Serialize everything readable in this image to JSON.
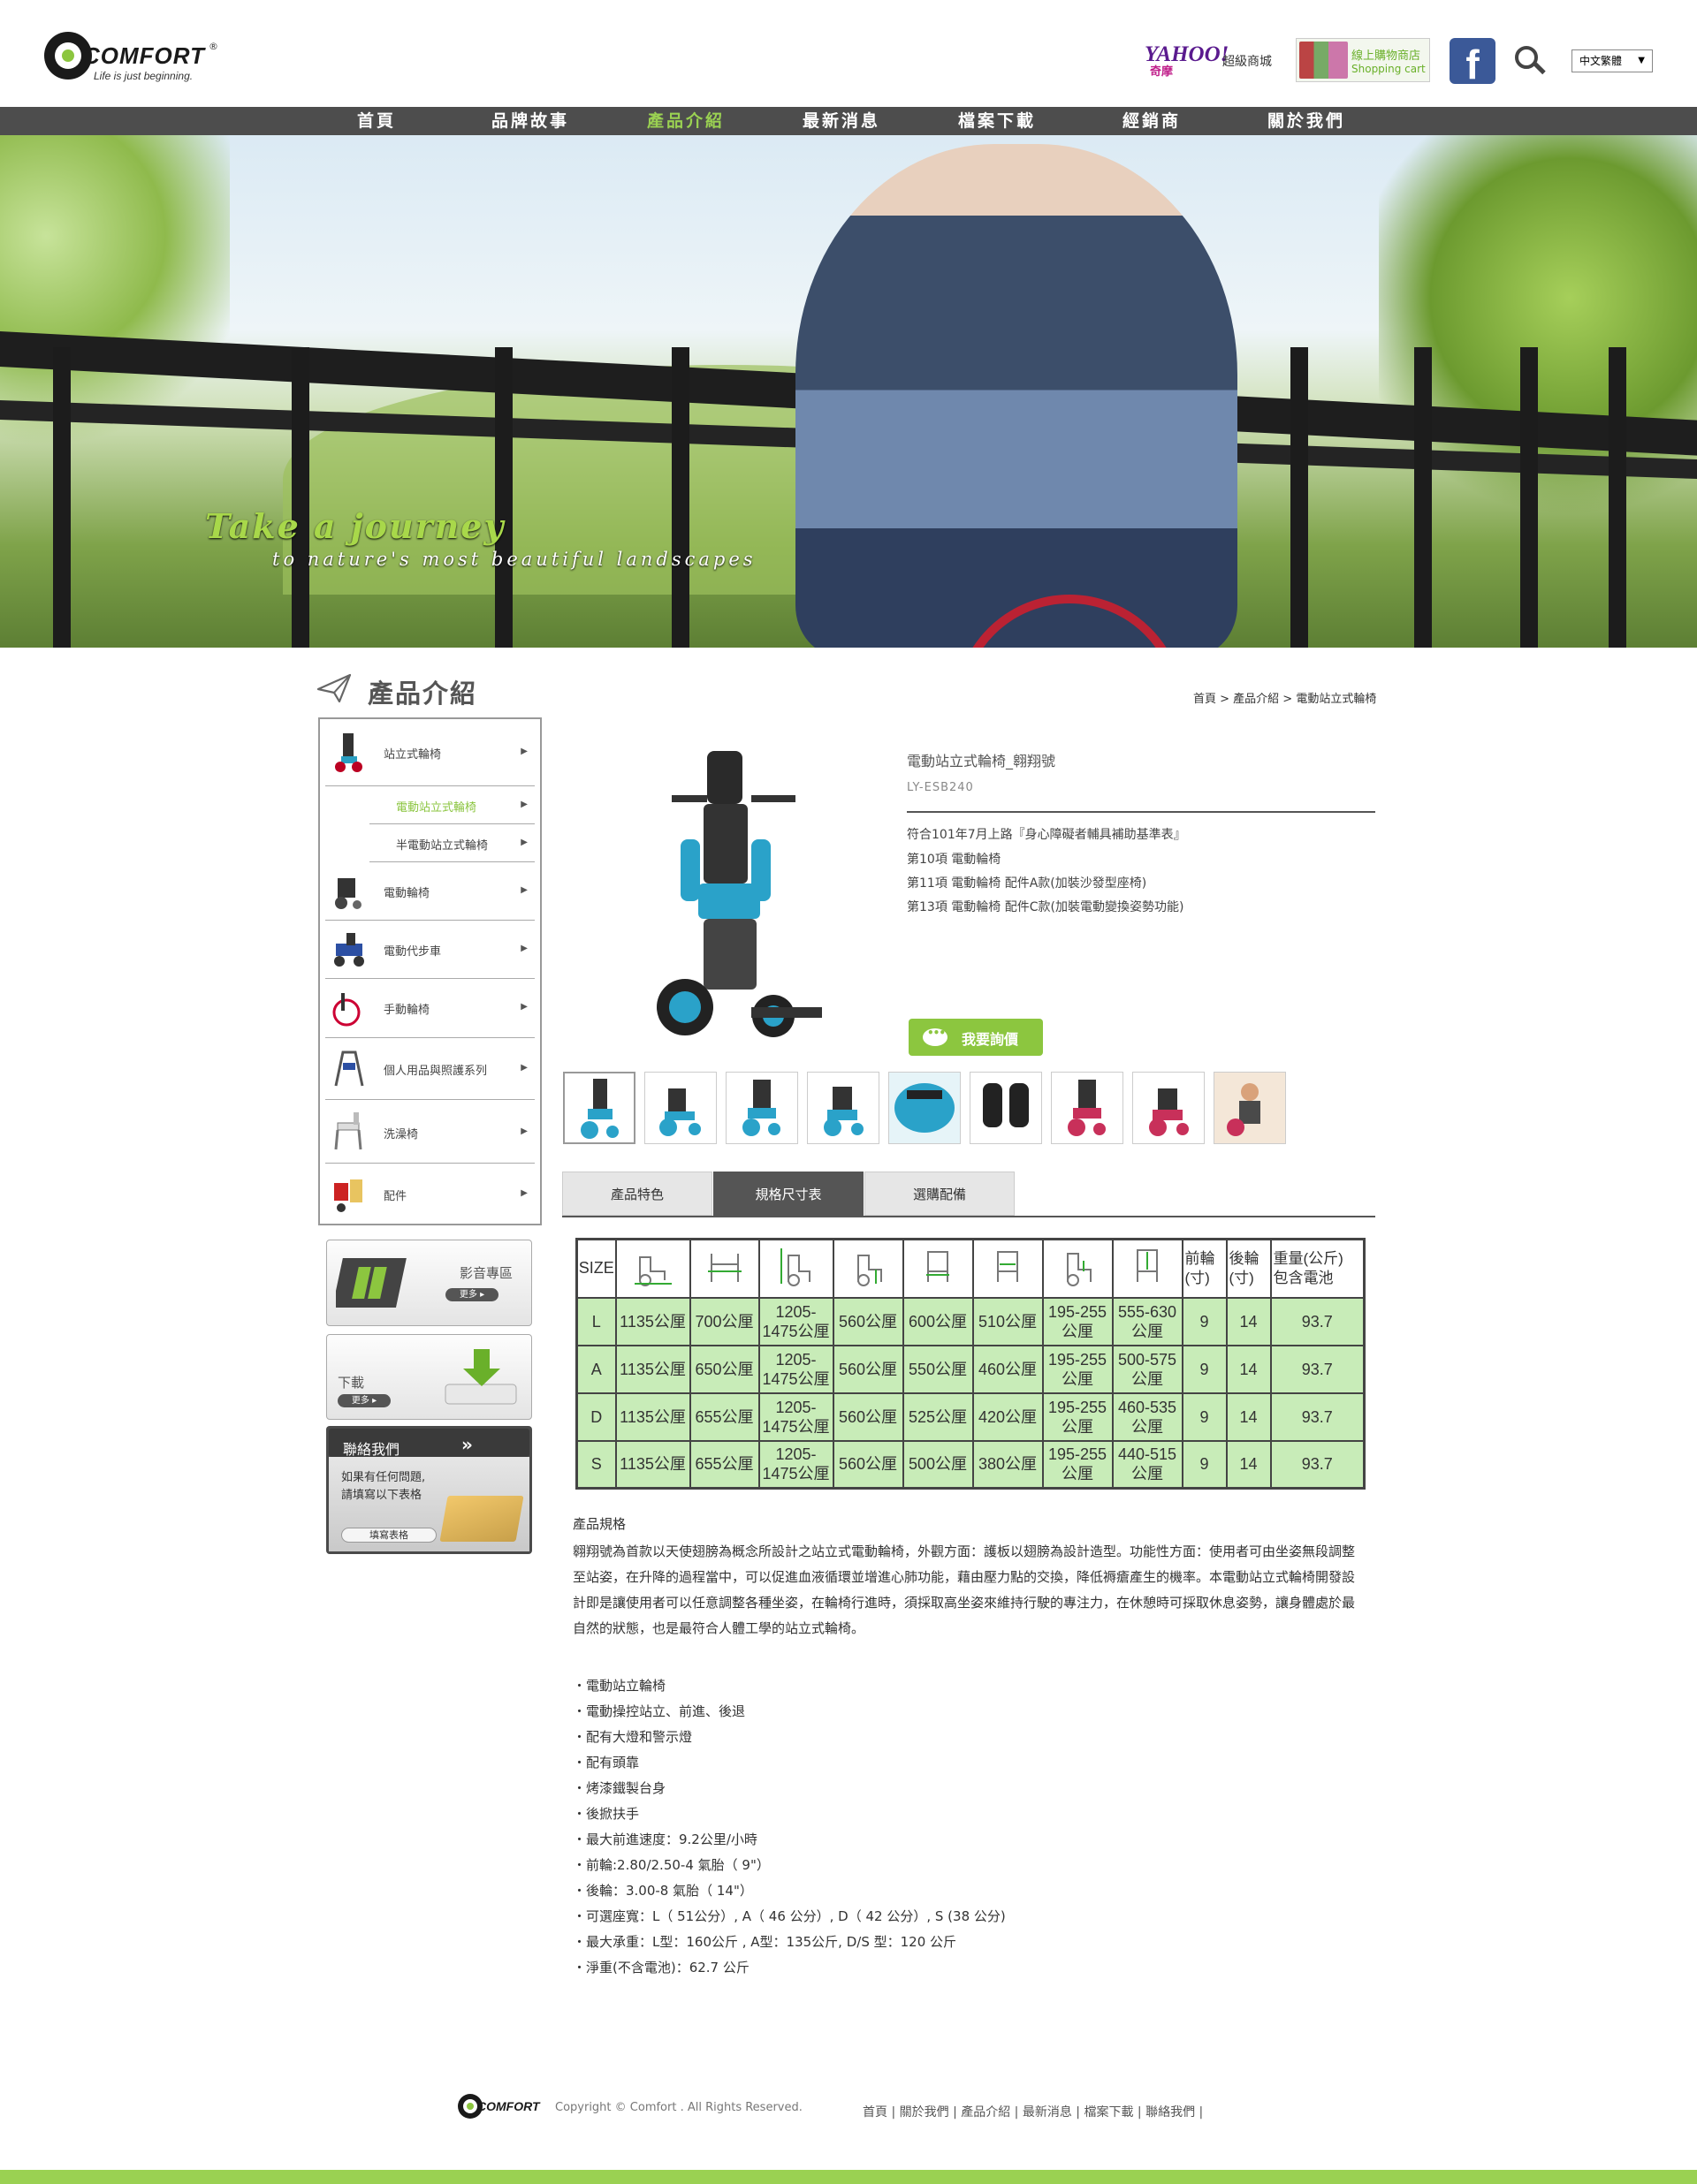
{
  "header": {
    "logo_word": "COMFORT",
    "logo_reg": "®",
    "logo_tagline": "Life is just beginning.",
    "yahoo_logo": "YAHOO!",
    "yahoo_sub": "奇摩",
    "yahoo_label": "超級商城",
    "cart_line1": "線上購物商店",
    "cart_line2": "Shopping cart",
    "facebook_icon": "f",
    "language": "中文繁體",
    "language_arrow": "▼"
  },
  "nav": [
    {
      "label": "首頁",
      "active": false
    },
    {
      "label": "品牌故事",
      "active": false
    },
    {
      "label": "產品介紹",
      "active": true
    },
    {
      "label": "最新消息",
      "active": false
    },
    {
      "label": "檔案下載",
      "active": false
    },
    {
      "label": "經銷商",
      "active": false
    },
    {
      "label": "關於我們",
      "active": false
    }
  ],
  "hero": {
    "headline": "Take a journey",
    "subline": "to nature's most beautiful landscapes"
  },
  "section_title": "產品介紹",
  "breadcrumb": "首頁 > 產品介紹 > 電動站立式輪椅",
  "sidebar": {
    "categories": [
      {
        "label": "站立式輪椅",
        "arrow": "▶",
        "icon": "standing-wheelchair-icon"
      },
      {
        "label": "電動輪椅",
        "arrow": "▶",
        "icon": "power-wheelchair-icon"
      },
      {
        "label": "電動代步車",
        "arrow": "▶",
        "icon": "mobility-scooter-icon"
      },
      {
        "label": "手動輪椅",
        "arrow": "▶",
        "icon": "manual-wheelchair-icon"
      },
      {
        "label": "個人用品與照護系列",
        "arrow": "▶",
        "icon": "walker-icon"
      },
      {
        "label": "洗澡椅",
        "arrow": "▶",
        "icon": "shower-chair-icon"
      },
      {
        "label": "配件",
        "arrow": "▶",
        "icon": "accessories-icon"
      }
    ],
    "subitems": [
      {
        "label": "電動站立式輪椅",
        "arrow": "▶",
        "active": true
      },
      {
        "label": "半電動站立式輪椅",
        "arrow": "▶",
        "active": false
      }
    ],
    "video_box": {
      "title": "影音專區",
      "more": "更多 ▸"
    },
    "download_box": {
      "title": "下載",
      "more": "更多 ▸"
    },
    "contact_box": {
      "title": "聯絡我們",
      "chevron": "»",
      "line1": "如果有任何問題,",
      "line2": "請填寫以下表格",
      "button": "填寫表格"
    }
  },
  "product": {
    "title": "電動站立式輪椅_翱翔號",
    "code": "LY-ESB240",
    "description": [
      "符合101年7月上路『身心障礙者輔具補助基準表』",
      "第10項 電動輪椅",
      "第11項 電動輪椅 配件A款(加裝沙發型座椅)",
      "第13項 電動輪椅 配件C款(加裝電動變換姿勢功能)"
    ],
    "inquiry_button": "我要詢價",
    "gallery_count": 9
  },
  "tabs": [
    {
      "label": "產品特色",
      "active": false
    },
    {
      "label": "規格尺寸表",
      "active": true
    },
    {
      "label": "選購配備",
      "active": false
    }
  ],
  "spec_table": {
    "headers": [
      "SIZE",
      "",
      "",
      "",
      "",
      "",
      "",
      "",
      "",
      "前輪\n(寸)",
      "後輪\n(寸)",
      "重量(公斤)\n包含電池"
    ],
    "rows": [
      [
        "L",
        "1135公厘",
        "700公厘",
        "1205-\n1475公厘",
        "560公厘",
        "600公厘",
        "510公厘",
        "195-255\n公厘",
        "555-630\n公厘",
        "9",
        "14",
        "93.7"
      ],
      [
        "A",
        "1135公厘",
        "650公厘",
        "1205-\n1475公厘",
        "560公厘",
        "550公厘",
        "460公厘",
        "195-255\n公厘",
        "500-575\n公厘",
        "9",
        "14",
        "93.7"
      ],
      [
        "D",
        "1135公厘",
        "655公厘",
        "1205-\n1475公厘",
        "560公厘",
        "525公厘",
        "420公厘",
        "195-255\n公厘",
        "460-535\n公厘",
        "9",
        "14",
        "93.7"
      ],
      [
        "S",
        "1135公厘",
        "655公厘",
        "1205-\n1475公厘",
        "560公厘",
        "500公厘",
        "380公厘",
        "195-255\n公厘",
        "440-515\n公厘",
        "9",
        "14",
        "93.7"
      ]
    ]
  },
  "spec_text": {
    "heading": "產品規格",
    "paragraph": "翱翔號為首款以天使翅膀為概念所設計之站立式電動輪椅，外觀方面：護板以翅膀為設計造型。功能性方面：使用者可由坐姿無段調整至站姿，在升降的過程當中，可以促進血液循環並增進心肺功能，藉由壓力點的交換，降低褥瘡產生的機率。本電動站立式輪椅開發設計即是讓使用者可以任意調整各種坐姿，在輪椅行進時，須採取高坐姿來維持行駛的專注力，在休憩時可採取休息姿勢，讓身體處於最自然的狀態，也是最符合人體工學的站立式輪椅。",
    "bullets": [
      "・電動站立輪椅",
      "・電動操控站立、前進、後退",
      "・配有大燈和警示燈",
      "・配有頭靠",
      "・烤漆鐵製台身",
      "・後掀扶手",
      "・最大前進速度：9.2公里/小時",
      "・前輪:2.80/2.50-4 氣胎（ 9\"）",
      "・後輪：3.00-8 氣胎（ 14\"）",
      "・可選座寬：L（ 51公分）, A（ 46 公分）, D（ 42 公分）, S (38 公分)",
      "・最大承重：L型：160公斤 , A型：135公斤, D/S 型：120 公斤",
      "・淨重(不含電池)：62.7 公斤"
    ]
  },
  "footer": {
    "logo_word": "COMFORT",
    "copyright": "Copyright © Comfort . All Rights Reserved.",
    "links": "首頁 | 關於我們 | 產品介紹 | 最新消息 | 檔案下載 | 聯絡我們 |"
  },
  "colors": {
    "accent_green": "#8cc63f",
    "nav_bg": "#4d4d4d",
    "table_cell": "#c8ecb8"
  }
}
